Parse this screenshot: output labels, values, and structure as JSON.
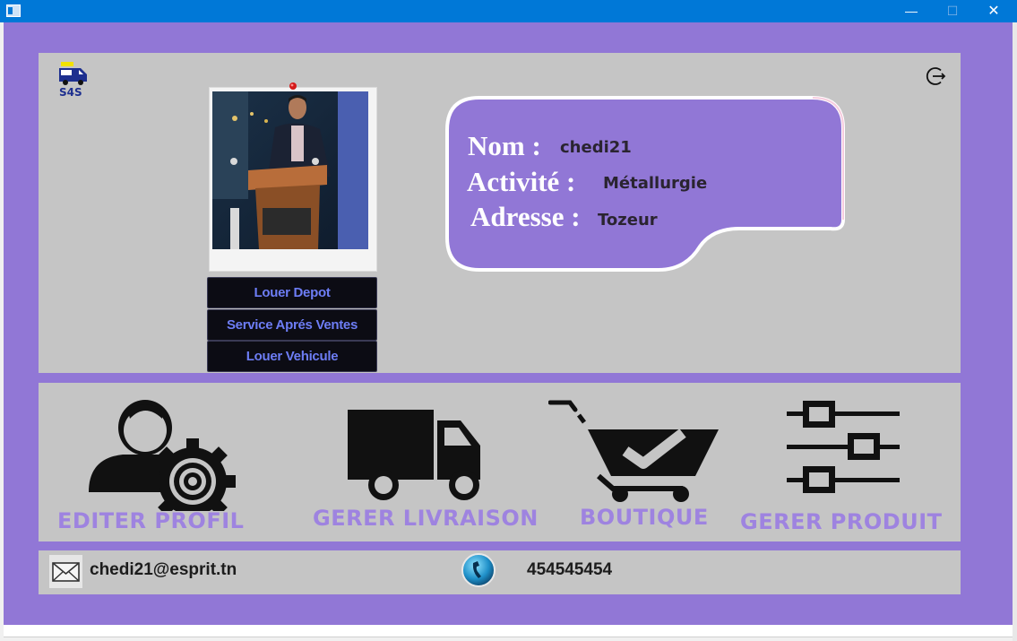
{
  "window": {
    "minimize_glyph": "—",
    "maximize_glyph": "☐",
    "close_glyph": "✕"
  },
  "brand": {
    "logo_text": "S4S",
    "logo_icon": "delivery-van-icon"
  },
  "profile": {
    "photo_icon": "user-photo",
    "labels": {
      "nom": "Nom :",
      "activite": "Activité :",
      "adresse": "Adresse :"
    },
    "values": {
      "nom": "chedi21",
      "activite": "Métallurgie",
      "adresse": "Tozeur"
    }
  },
  "menu": {
    "louer_depot": "Louer Depot",
    "service_apres_ventes": "Service Aprés Ventes",
    "louer_vehicule": "Louer Vehicule"
  },
  "actions": {
    "editer_profil": {
      "label": "EDITER PROFIL",
      "icon": "user-gear-icon"
    },
    "gerer_livraison": {
      "label": "GERER LIVRAISON",
      "icon": "truck-icon"
    },
    "boutique": {
      "label": "BOUTIQUE",
      "icon": "shopping-cart-check-icon"
    },
    "gerer_produit": {
      "label": "GERER PRODUIT",
      "icon": "sliders-icon"
    }
  },
  "contact": {
    "email": "chedi21@esprit.tn",
    "phone": "454545454",
    "email_icon": "envelope-icon",
    "phone_icon": "phone-icon"
  },
  "colors": {
    "frame": "#9177d6",
    "panel": "#c5c5c5",
    "bubble": "#9177d6",
    "menu_bg": "#0c0c14",
    "menu_text": "#6d7df5",
    "action_label": "#9e83e0"
  }
}
